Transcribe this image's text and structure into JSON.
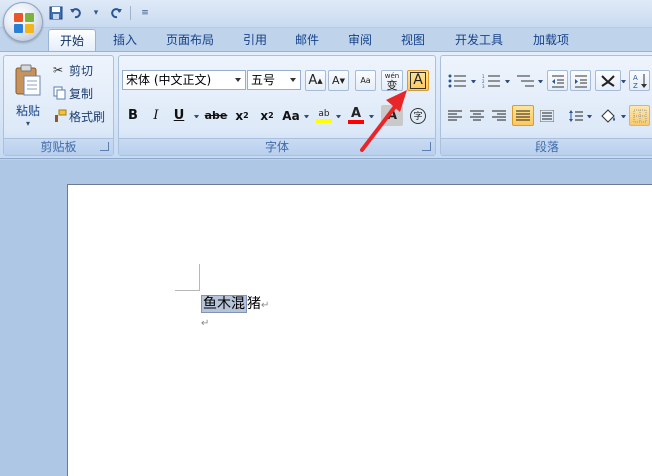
{
  "quick_access": {
    "customize_symbol": "≡"
  },
  "tabs": [
    {
      "label": "开始",
      "active": true
    },
    {
      "label": "插入"
    },
    {
      "label": "页面布局"
    },
    {
      "label": "引用"
    },
    {
      "label": "邮件"
    },
    {
      "label": "审阅"
    },
    {
      "label": "视图"
    },
    {
      "label": "开发工具"
    },
    {
      "label": "加载项"
    }
  ],
  "clipboard": {
    "group_label": "剪贴板",
    "paste_label": "粘贴",
    "cut_label": "剪切",
    "copy_label": "复制",
    "format_painter_label": "格式刷"
  },
  "font": {
    "group_label": "字体",
    "font_name": "宋体 (中文正文)",
    "font_size": "五号",
    "grow_label": "A",
    "shrink_label": "A",
    "clear_label": "Aa",
    "phonetic_label": "wén",
    "phonetic_char": "变",
    "char_border_label": "A",
    "bold": "B",
    "italic": "I",
    "underline": "U",
    "strike": "abe",
    "subscript": "x",
    "subscript_mark": "2",
    "superscript": "x",
    "superscript_mark": "2",
    "change_case": "Aa",
    "highlight": "ab",
    "font_color": "A",
    "char_shading": "A",
    "enclose_char": "字"
  },
  "paragraph": {
    "group_label": "段落"
  },
  "document": {
    "selected_text": "鱼木混",
    "rest_text": "猪",
    "para_mark": "↵"
  },
  "colors": {
    "highlight": "#ffff00",
    "font_color": "#ff0000",
    "annotation_arrow": "#e8262a"
  }
}
